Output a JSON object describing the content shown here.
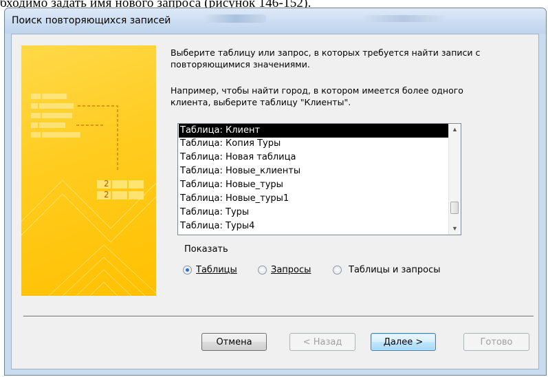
{
  "top_text": "бходимо задать имя нового запроса (рисунок 146-152).",
  "window": {
    "title": "Поиск повторяющихся записей"
  },
  "instructions": {
    "line1": "Выберите таблицу или запрос, в которых требуется найти записи с",
    "line2": "повторяющимися значениями.",
    "line3": "Например, чтобы найти город, в котором имеется более одного",
    "line4": "клиента, выберите таблицу \"Клиенты\"."
  },
  "list": {
    "selected_index": 0,
    "items": [
      "Таблица: Клиент",
      "Таблица: Копия Туры",
      "Таблица: Новая таблица",
      "Таблица: Новые_клиенты",
      "Таблица: Новые_туры",
      "Таблица: Новые_туры1",
      "Таблица: Туры",
      "Таблица: Туры4"
    ]
  },
  "show": {
    "label": "Показать",
    "options": [
      {
        "label": "Таблицы",
        "checked": true
      },
      {
        "label": "Запросы",
        "checked": false
      },
      {
        "label": "Таблицы и запросы",
        "checked": false
      }
    ]
  },
  "buttons": {
    "cancel": "Отмена",
    "back": "< Назад",
    "next": "Далее >",
    "finish": "Готово"
  },
  "banner_digits": [
    "2",
    "2"
  ],
  "colors": {
    "banner": "#ffc000",
    "selection": "#000000",
    "window_frame": "#c9dbef"
  }
}
